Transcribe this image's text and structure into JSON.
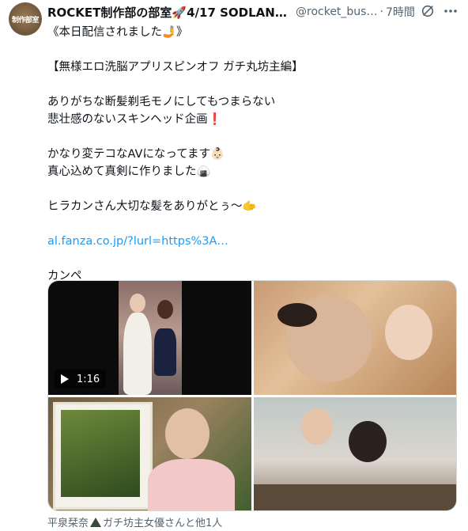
{
  "author": {
    "display_name": "ROCKET制作部の部室🚀4/17 SODLANDリ…",
    "handle": "@rocket_bus…",
    "separator": "·",
    "time": "7時間",
    "avatar_text": "制作部室"
  },
  "tweet": {
    "lines": [
      "《本日配信されました🤳》",
      "",
      "【無様エロ洗脳アプリスピンオフ ガチ丸坊主編】",
      "",
      "ありがちな断髪剃毛モノにしてもつまらない",
      "悲壮感のないスキンヘッド企画❗",
      "",
      "かなり変テコなAVになってます👶🏻",
      "真心込めて真剣に作りました🍙",
      "",
      "ヒラカンさん大切な髪をありがとぅ〜🫱"
    ],
    "link": "al.fanza.co.jp/?lurl=https%3A…",
    "tail": "カンペ"
  },
  "media": {
    "video_duration": "1:16"
  },
  "tagged": {
    "first": "平泉栞奈",
    "rest": "ガチ坊主女優さんと他1人"
  },
  "icons": {
    "grok": "grok-icon",
    "more": "more-icon",
    "play": "play-icon",
    "tag": "triangle-icon"
  }
}
